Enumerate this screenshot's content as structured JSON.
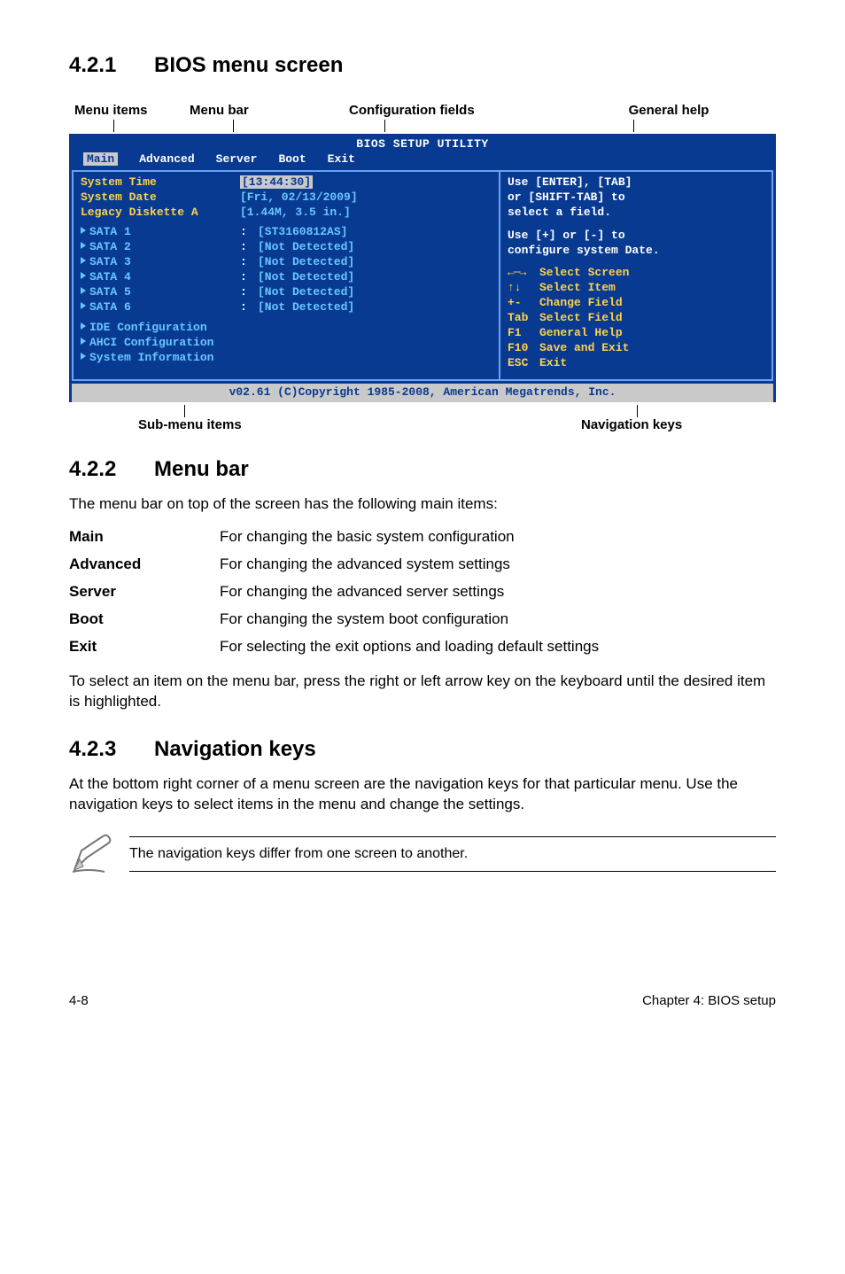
{
  "sec421_num": "4.2.1",
  "sec421_title": "BIOS menu screen",
  "top_labels": {
    "menu_items": "Menu items",
    "menu_bar": "Menu bar",
    "config_fields": "Configuration fields",
    "general_help": "General help"
  },
  "bios": {
    "title": "BIOS SETUP UTILITY",
    "menubar": [
      "Main",
      "Advanced",
      "Server",
      "Boot",
      "Exit"
    ],
    "selected_tab": "Main",
    "left": {
      "sys_time_lbl": "System Time",
      "sys_time_val": "[13:44:30]",
      "sys_date_lbl": "System Date",
      "sys_date_val": "[Fri, 02/13/2009]",
      "legacy_lbl": "Legacy Diskette A",
      "legacy_val": "[1.44M, 3.5 in.]",
      "sata1_lbl": "SATA 1",
      "sata1_val": "[ST3160812AS]",
      "sata2_lbl": "SATA 2",
      "sata2_val": "[Not Detected]",
      "sata3_lbl": "SATA 3",
      "sata3_val": "[Not Detected]",
      "sata4_lbl": "SATA 4",
      "sata4_val": "[Not Detected]",
      "sata5_lbl": "SATA 5",
      "sata5_val": "[Not Detected]",
      "sata6_lbl": "SATA 6",
      "sata6_val": "[Not Detected]",
      "ide_cfg": "IDE Configuration",
      "ahci_cfg": "AHCI Configuration",
      "sys_info": "System Information"
    },
    "right_help": {
      "line1": "Use [ENTER], [TAB]",
      "line2": "or [SHIFT-TAB] to",
      "line3": "select a field.",
      "line4": "Use [+] or [-] to",
      "line5": "configure system Date."
    },
    "nav": {
      "arrow_lr": "←─→",
      "sel_screen": "Select Screen",
      "arrow_ud": "↑↓",
      "sel_item": "Select Item",
      "pm": "+-",
      "change_field": "Change Field",
      "tab": "Tab",
      "sel_field": "Select Field",
      "f1": "F1",
      "gen_help": "General Help",
      "f10": "F10",
      "save_exit": "Save and Exit",
      "esc": "ESC",
      "exit": "Exit"
    },
    "status": "v02.61 (C)Copyright 1985-2008, American Megatrends, Inc."
  },
  "bottom_labels": {
    "sub_items": "Sub-menu items",
    "nav_keys": "Navigation keys"
  },
  "sec422_num": "4.2.2",
  "sec422_title": "Menu bar",
  "sec422_intro": "The menu bar on top of the screen has the following main items:",
  "defs": {
    "main_t": "Main",
    "main_d": "For changing the basic system configuration",
    "adv_t": "Advanced",
    "adv_d": "For changing the advanced system settings",
    "srv_t": "Server",
    "srv_d": "For changing the advanced server settings",
    "boot_t": "Boot",
    "boot_d": "For changing the system boot configuration",
    "exit_t": "Exit",
    "exit_d": "For selecting the exit options and loading default settings"
  },
  "sec422_outro": "To select an item on the menu bar, press the right or left arrow key on the keyboard until the desired item is highlighted.",
  "sec423_num": "4.2.3",
  "sec423_title": "Navigation keys",
  "sec423_body": "At the bottom right corner of a menu screen are the navigation keys for that particular menu. Use the navigation keys to select items in the menu and change the settings.",
  "note_text": "The navigation keys differ from one screen to another.",
  "footer_left": "4-8",
  "footer_right": "Chapter 4: BIOS setup"
}
